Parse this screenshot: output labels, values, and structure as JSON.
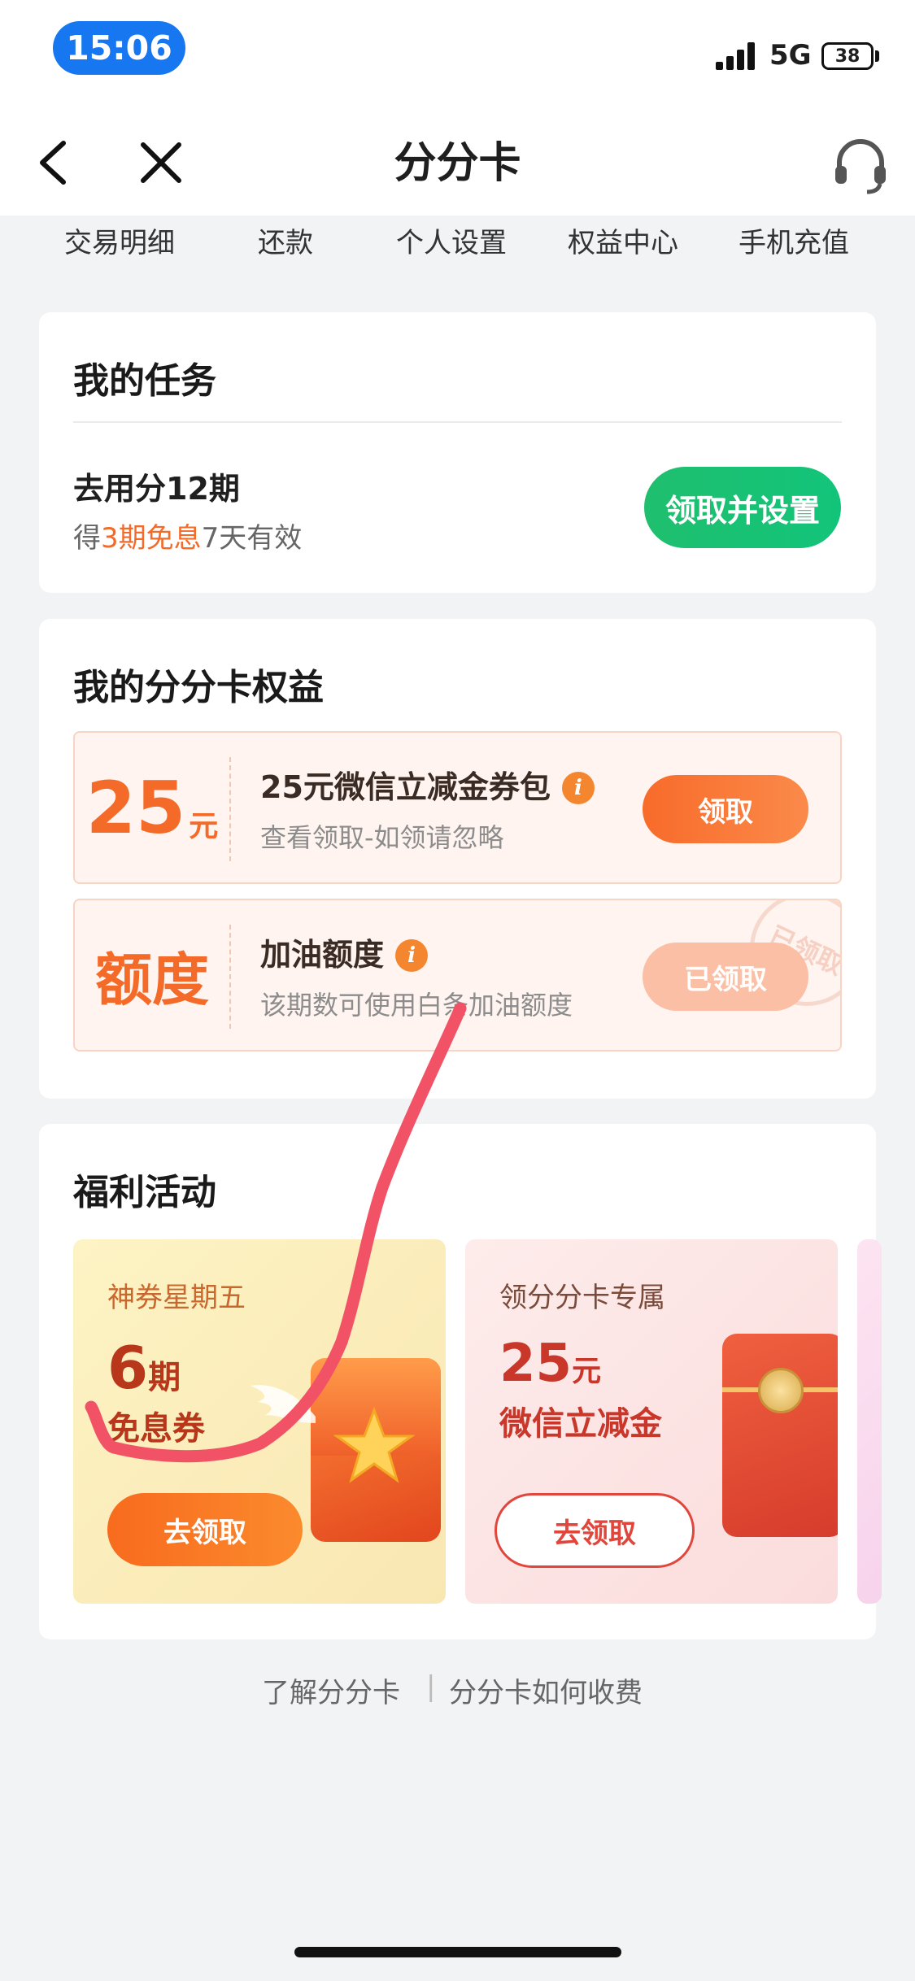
{
  "status_bar": {
    "time": "15:06",
    "network": "5G",
    "battery": "38"
  },
  "nav": {
    "title": "分分卡"
  },
  "tabs": [
    "交易明细",
    "还款",
    "个人设置",
    "权益中心",
    "手机充值"
  ],
  "tasks": {
    "title": "我的任务",
    "item": {
      "name": "去用分12期",
      "desc_prefix": "得",
      "desc_highlight": "3期免息",
      "desc_suffix": "7天有效",
      "button": "领取并设置"
    }
  },
  "benefits": {
    "title": "我的分分卡权益",
    "items": [
      {
        "left_value": "25",
        "left_unit": "元",
        "title": "25元微信立减金券包",
        "sub": "查看领取-如领请忽略",
        "button": "领取",
        "info": "i"
      },
      {
        "left_value": "额度",
        "left_unit": "",
        "title": "加油额度",
        "sub": "该期数可使用白条加油额度",
        "button": "已领取",
        "stamp": "已领取",
        "info": "i"
      }
    ]
  },
  "welfare": {
    "title": "福利活动",
    "cards": [
      {
        "tag": "神券星期五",
        "big": "6",
        "big_unit": "期",
        "line2": "免息券",
        "button": "去领取"
      },
      {
        "tag": "领分分卡专属",
        "big": "25",
        "big_unit": "元",
        "line2": "微信立减金",
        "button": "去领取"
      }
    ]
  },
  "footer": {
    "link1": "了解分分卡",
    "separator": "|",
    "link2": "分分卡如何收费"
  },
  "colors": {
    "accent_blue": "#1677f0",
    "green": "#1fbf6e",
    "orange": "#f46a28",
    "red_outline": "#e0463c"
  }
}
